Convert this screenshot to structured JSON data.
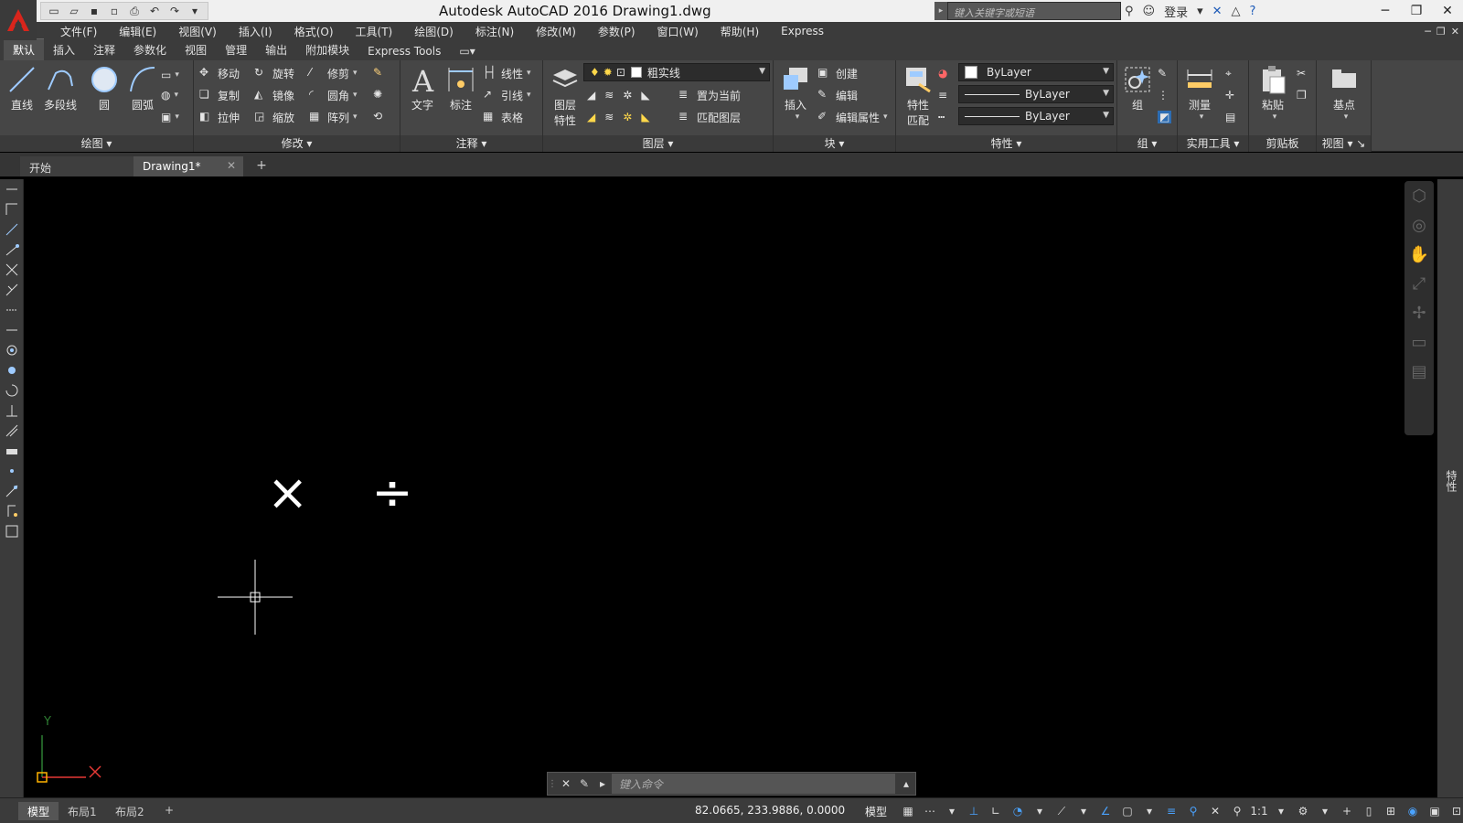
{
  "window": {
    "title": "Autodesk AutoCAD 2016    Drawing1.dwg",
    "search_placeholder": "键入关键字或短语",
    "login": "登录"
  },
  "menu": {
    "items": [
      "文件(F)",
      "编辑(E)",
      "视图(V)",
      "插入(I)",
      "格式(O)",
      "工具(T)",
      "绘图(D)",
      "标注(N)",
      "修改(M)",
      "参数(P)",
      "窗口(W)",
      "帮助(H)",
      "Express"
    ]
  },
  "ribbon_tabs": [
    "默认",
    "插入",
    "注释",
    "参数化",
    "视图",
    "管理",
    "输出",
    "附加模块",
    "Express Tools"
  ],
  "ribbon": {
    "draw": {
      "title": "绘图",
      "line": "直线",
      "polyline": "多段线",
      "circle": "圆",
      "arc": "圆弧"
    },
    "modify": {
      "title": "修改",
      "move": "移动",
      "rotate": "旋转",
      "trim": "修剪",
      "copy": "复制",
      "mirror": "镜像",
      "fillet": "圆角",
      "stretch": "拉伸",
      "scale": "缩放",
      "array": "阵列"
    },
    "annotation": {
      "title": "注释",
      "text": "文字",
      "dimension": "标注",
      "linear": "线性",
      "leader": "引线",
      "table": "表格"
    },
    "layers": {
      "title": "图层",
      "layer_props_1": "图层",
      "layer_props_2": "特性",
      "current_layer": "粗实线",
      "set_current": "置为当前",
      "match_layer": "匹配图层"
    },
    "block": {
      "title": "块",
      "insert": "插入",
      "create": "创建",
      "edit": "编辑",
      "edit_attr": "编辑属性"
    },
    "properties": {
      "title": "特性",
      "match_1": "特性",
      "match_2": "匹配",
      "color": "ByLayer",
      "lineweight": "ByLayer",
      "linetype": "ByLayer"
    },
    "groups": {
      "title": "组",
      "group": "组"
    },
    "utilities": {
      "title": "实用工具",
      "measure": "测量"
    },
    "clipboard": {
      "title": "剪贴板",
      "paste": "粘贴"
    },
    "view": {
      "title": "视图",
      "base": "基点"
    }
  },
  "file_tabs": {
    "start": "开始",
    "drawing": "Drawing1*"
  },
  "canvas": {
    "symbols": "× ÷"
  },
  "ucs": {
    "y": "Y",
    "x": "X"
  },
  "side_panel": {
    "label": "特性"
  },
  "command_line": {
    "placeholder": "键入命令"
  },
  "layout_tabs": [
    "模型",
    "布局1",
    "布局2"
  ],
  "status": {
    "coordinates": "82.0665, 233.9886, 0.0000",
    "model": "模型",
    "scale": "1:1"
  },
  "colors": {
    "accent": "#1e88e5",
    "ucs_x": "#e53935",
    "ucs_y": "#2e7d32"
  }
}
